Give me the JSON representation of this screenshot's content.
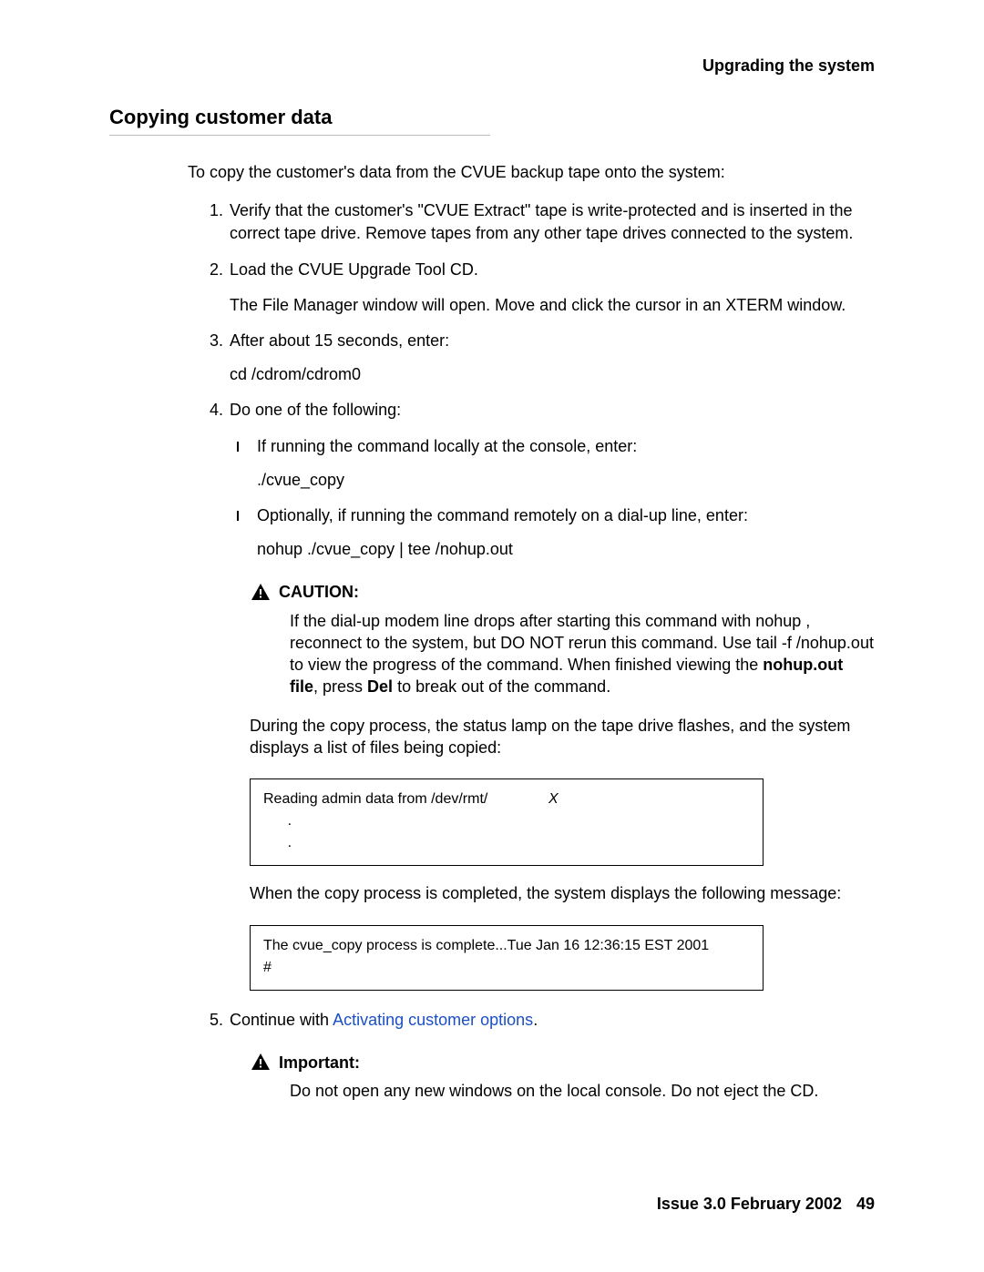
{
  "header": {
    "running": "Upgrading the system"
  },
  "section": {
    "title": "Copying customer data"
  },
  "intro": "To copy the customer's data from the CVUE backup tape onto the system:",
  "steps": {
    "s1": {
      "num": "1.",
      "text": "Verify that the customer's \"CVUE Extract\" tape is write-protected and is inserted in the correct tape drive. Remove tapes from any other tape drives connected to the system."
    },
    "s2": {
      "num": "2.",
      "text": "Load the CVUE Upgrade Tool CD.",
      "follow": "The File Manager window will open. Move and click the cursor in an XTERM window."
    },
    "s3": {
      "num": "3.",
      "text": "After about 15 seconds, enter:",
      "code": "cd /cdrom/cdrom0"
    },
    "s4": {
      "num": "4.",
      "text": "Do one of the following:",
      "opt1": {
        "text": "If running the command locally at the console, enter:",
        "code": "./cvue_copy"
      },
      "opt2": {
        "text": "Optionally, if running the command remotely on a dial-up line, enter:",
        "code": "nohup ./cvue_copy | tee /nohup.out"
      },
      "caution": {
        "label": "CAUTION:",
        "body_pre": "If the dial-up modem line drops after starting this command with nohup , reconnect to the system, but DO NOT rerun this command. Use tail -f /nohup.out      to view the progress of the command. When finished viewing the ",
        "bold1": "nohup.out file",
        "mid": ", press ",
        "bold2": "Del",
        "post": " to break out of the command."
      },
      "during": "During the copy process, the status lamp on the tape drive flashes, and the system displays a list of files being copied:",
      "term1_a": "Reading admin data from /dev/rmt/",
      "term1_x": "X",
      "term1_dots1": "      .",
      "term1_dots2": "      .",
      "after": "When the copy process is completed, the system displays the following message:",
      "term2_line1": "The cvue_copy process is complete...Tue Jan 16 12:36:15 EST 2001",
      "term2_line2": "#"
    },
    "s5": {
      "num": "5.",
      "text_pre": "Continue with ",
      "link": "Activating customer options",
      "text_post": ".",
      "important": {
        "label": "Important:",
        "body": "Do not open any new windows on the local console. Do not eject the CD."
      }
    }
  },
  "footer": {
    "issue": "Issue 3.0   February 2002",
    "page": "49"
  }
}
